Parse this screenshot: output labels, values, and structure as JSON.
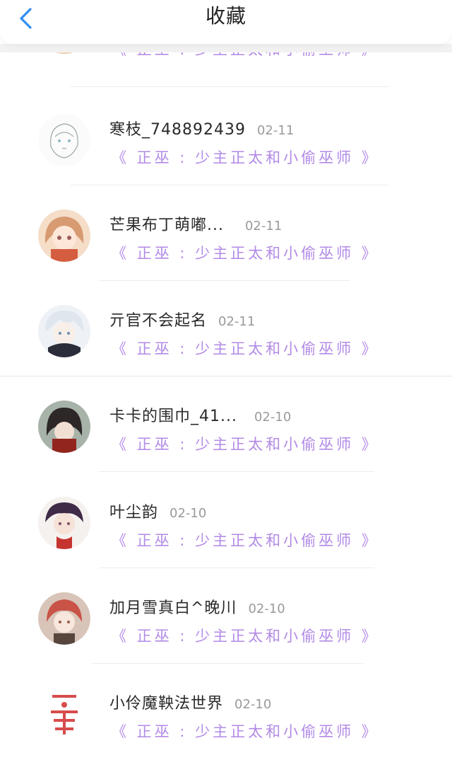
{
  "header": {
    "title": "收藏"
  },
  "rows": [
    {
      "name": "",
      "date": "",
      "source": "《 正巫 : 少主正太和小偷巫师 》",
      "avatar": "avatar-1"
    },
    {
      "name": "寒枝_748892439",
      "date": "02-11",
      "source": "《 正巫 : 少主正太和小偷巫师 》",
      "avatar": "avatar-2"
    },
    {
      "name": "芒果布丁萌嘟...",
      "date": "02-11",
      "source": "《 正巫 : 少主正太和小偷巫师 》",
      "avatar": "avatar-3"
    },
    {
      "name": "亓官不会起名",
      "date": "02-11",
      "source": "《 正巫 : 少主正太和小偷巫师 》",
      "avatar": "avatar-4"
    },
    {
      "name": "卡卡的围巾_41...",
      "date": "02-10",
      "source": "《 正巫 : 少主正太和小偷巫师 》",
      "avatar": "avatar-5"
    },
    {
      "name": "叶尘韵",
      "date": "02-10",
      "source": "《 正巫 : 少主正太和小偷巫师 》",
      "avatar": "avatar-6"
    },
    {
      "name": "加月雪真白^晚川",
      "date": "02-10",
      "source": "《 正巫 : 少主正太和小偷巫师 》",
      "avatar": "avatar-7"
    },
    {
      "name": "小伶魔鞅法世界",
      "date": "02-10",
      "source": "《 正巫 : 少主正太和小偷巫师 》",
      "avatar": "avatar-8"
    }
  ],
  "avatar_logo_text": "虐",
  "colors": {
    "accent": "#2f8df3",
    "source_text": "#b28ae6",
    "date_text": "#9a9a9a"
  }
}
